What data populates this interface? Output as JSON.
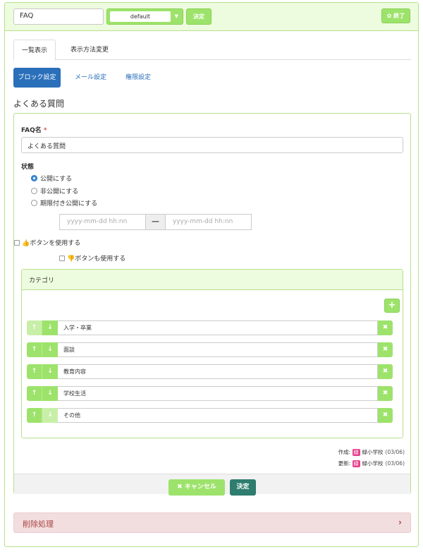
{
  "topbar": {
    "frame_title": "FAQ",
    "style_value": "default",
    "decide_label": "決定",
    "end_label": "✿ 終了"
  },
  "tabs": [
    {
      "label": "一覧表示"
    },
    {
      "label": "表示方法変更"
    }
  ],
  "pills": [
    {
      "label": "ブロック設定"
    },
    {
      "label": "メール設定"
    },
    {
      "label": "権限設定"
    }
  ],
  "block_title": "よくある質問",
  "form": {
    "faq_name_label": "FAQ名",
    "required_mark": "*",
    "faq_name_value": "よくある質問",
    "status_label": "状態",
    "status_options": [
      "公開にする",
      "非公開にする",
      "期限付き公開にする"
    ],
    "status_selected": "公開にする",
    "date_from_placeholder": "yyyy-mm-dd hh:nn",
    "date_to_placeholder": "yyyy-mm-dd hh:nn",
    "date_separator": "—",
    "like_label": "ボタンを使用する",
    "unlike_label": "ボタンも使用する"
  },
  "category": {
    "title": "カテゴリ",
    "add_label": "+",
    "items": [
      "入学・卒業",
      "面談",
      "教育内容",
      "学校生活",
      "その他"
    ]
  },
  "meta": {
    "created_label": "作成:",
    "updated_label": "更新:",
    "badge": "緑",
    "created_by": "緑小学校",
    "created_date": "(03/06)",
    "updated_by": "緑小学校",
    "updated_date": "(03/06)"
  },
  "footer": {
    "cancel_label": "✖ キャンセル",
    "submit_label": "決定"
  },
  "danger": {
    "title": "削除処理"
  }
}
